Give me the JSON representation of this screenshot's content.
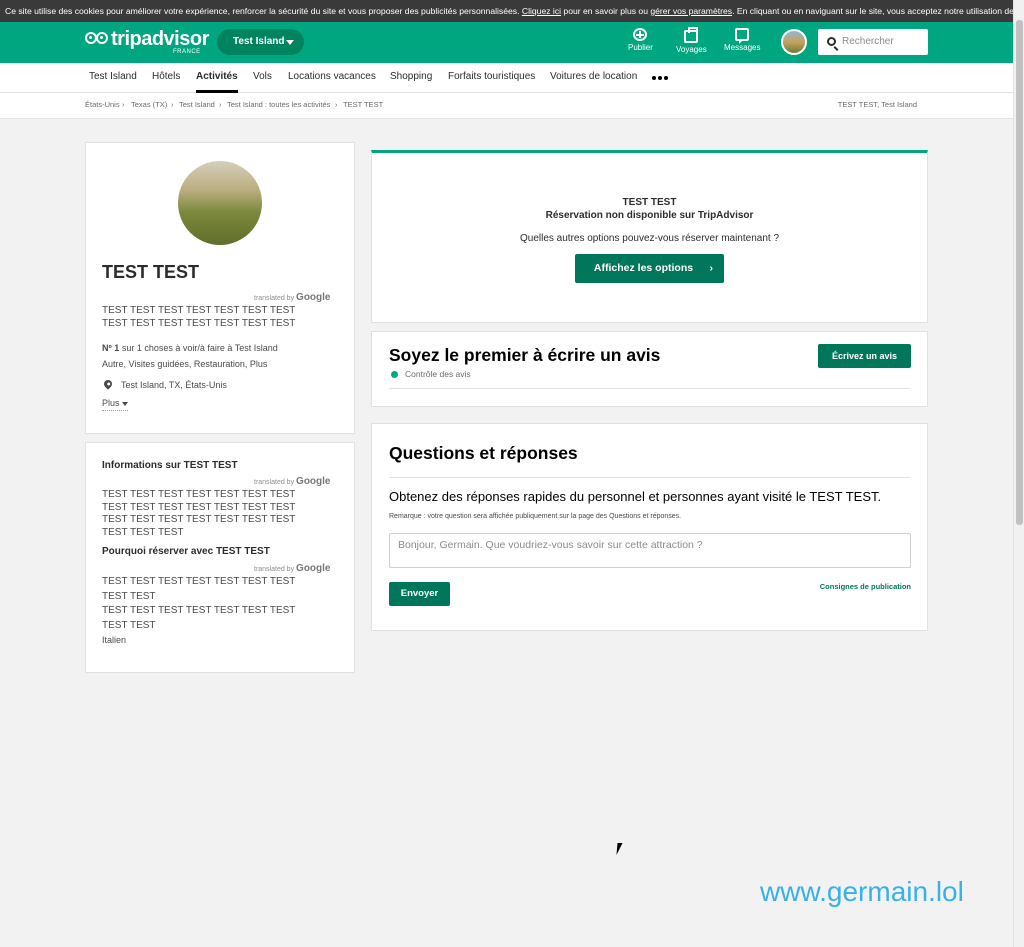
{
  "cookie_banner": {
    "text_start": "Ce site utilise des cookies pour améliorer votre expérience, renforcer la sécurité du site et vous proposer des publicités personnalisées.",
    "link1": "Cliquez ici",
    "text_mid": "pour en savoir plus ou",
    "link2": "gérer vos paramètres",
    "text_end": ". En cliquant ou en naviguant sur le site, vous acceptez notre utilisation des cookies."
  },
  "header": {
    "logo": "tripadvisor",
    "logo_sub": "FRANCE",
    "geo": "Test Island",
    "nav": [
      {
        "label": "Publier",
        "icon": "plus-circle-icon"
      },
      {
        "label": "Voyages",
        "icon": "suitcase-icon"
      },
      {
        "label": "Messages",
        "icon": "message-icon"
      }
    ],
    "search_placeholder": "Rechercher",
    "brand_color": "#00a680"
  },
  "subnav": {
    "items": [
      "Test Island",
      "Hôtels",
      "Activités",
      "Vols",
      "Locations vacances",
      "Shopping",
      "Forfaits touristiques",
      "Voitures de location"
    ],
    "active": "Activités",
    "more_icon": "more-dots-icon"
  },
  "breadcrumb": {
    "items": [
      "États-Unis",
      "Texas (TX)",
      "Test Island",
      "Test Island : toutes les activités",
      "TEST TEST"
    ],
    "separator": "›",
    "right": "TEST TEST, Test Island"
  },
  "profile": {
    "name": "TEST TEST",
    "translated_by": "translated by",
    "google": "Google",
    "description": [
      "TEST TEST TEST TEST TEST TEST TEST",
      "TEST TEST TEST TEST TEST TEST TEST"
    ],
    "rank_bold": "Nº 1",
    "rank_rest": "sur 1 choses à voir/à faire à Test Island",
    "categories": "Autre, Visites guidées, Restauration, Plus",
    "location": "Test Island, TX, États-Unis",
    "more": "Plus"
  },
  "info": {
    "title": "Informations sur TEST TEST",
    "translated_by": "translated by",
    "google": "Google",
    "lines": [
      "TEST TEST TEST TEST TEST TEST TEST",
      "TEST TEST TEST TEST TEST TEST TEST",
      "TEST TEST TEST TEST TEST TEST TEST",
      "TEST TEST TEST"
    ],
    "why_title": "Pourquoi réserver avec TEST TEST",
    "why_translated_by": "translated by",
    "why_google": "Google",
    "why_lines": [
      "TEST TEST TEST TEST TEST TEST TEST",
      "TEST TEST",
      "TEST TEST TEST TEST TEST TEST TEST",
      "TEST TEST"
    ],
    "language": "Italien"
  },
  "booking": {
    "title": "TEST TEST",
    "subtitle": "Réservation non disponible sur TripAdvisor",
    "question": "Quelles autres options pouvez-vous réserver maintenant ?",
    "button": "Affichez les options"
  },
  "reviews": {
    "title": "Soyez le premier à écrire un avis",
    "control": "Contrôle des avis",
    "button": "Écrivez un avis"
  },
  "qa": {
    "title": "Questions et réponses",
    "prompt": "Obtenez des réponses rapides du personnel et personnes ayant visité le TEST TEST.",
    "note": "Remarque : votre question sera affichée publiquement sur la page des Questions et réponses.",
    "placeholder": "Bonjour, Germain. Que voudriez-vous savoir sur cette attraction ?",
    "submit": "Envoyer",
    "guidelines": "Consignes de publication"
  },
  "watermark": "www.germain.lol"
}
